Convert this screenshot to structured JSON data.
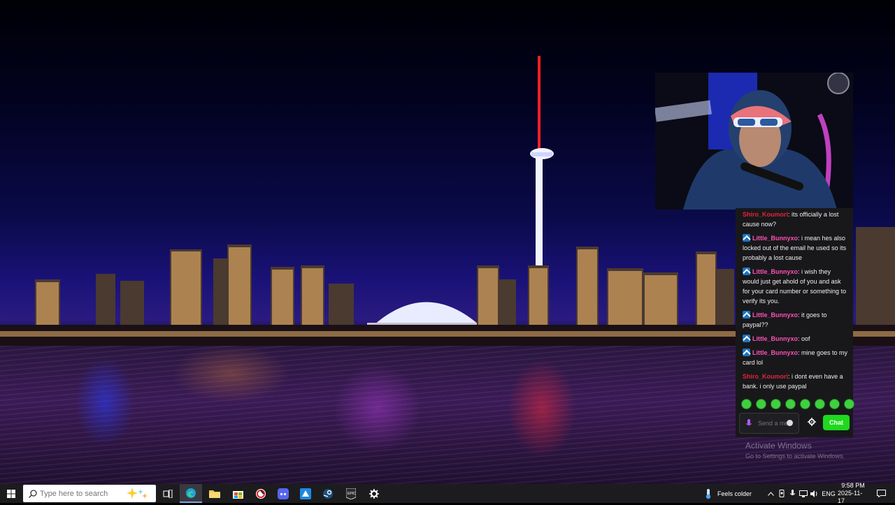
{
  "desktop": {
    "wallpaper": "toronto-skyline-night",
    "watermark": {
      "title": "Activate Windows",
      "subtitle": "Go to Settings to activate Windows."
    }
  },
  "chat": {
    "messages": [
      {
        "user": "Shiro_Koumori",
        "badge": false,
        "color": "#e0253a",
        "text": "its officially a lost cause now?"
      },
      {
        "user": "Little_Bunnyxo",
        "badge": true,
        "color": "#ff4fb6",
        "text": "i mean hes also locked out of the email he used so its probably a lost cause"
      },
      {
        "user": "Little_Bunnyxo",
        "badge": true,
        "color": "#ff4fb6",
        "text": "i wish they would just get ahold of you and ask for your card number or something to verify its you."
      },
      {
        "user": "Little_Bunnyxo",
        "badge": true,
        "color": "#ff4fb6",
        "text": "it goes to paypal??"
      },
      {
        "user": "Little_Bunnyxo",
        "badge": true,
        "color": "#ff4fb6",
        "text": "oof"
      },
      {
        "user": "Little_Bunnyxo",
        "badge": true,
        "color": "#ff4fb6",
        "text": "mine goes to my card lol"
      },
      {
        "user": "Shiro_Koumori",
        "badge": false,
        "color": "#e0253a",
        "text": "i dont even have a bank. i only use paypal"
      }
    ],
    "emote_count": 8,
    "input_placeholder": "Send a message",
    "send_label": "Chat",
    "accent": "#1ed91e"
  },
  "taskbar": {
    "search_placeholder": "Type here to search",
    "weather_text": "Feels colder",
    "language": "ENG",
    "time": "9:58 PM",
    "date": "2025-11-17",
    "pinned_apps": [
      "task-view",
      "edge",
      "file-explorer",
      "store",
      "app-red",
      "app-discord",
      "app-blue",
      "steam",
      "epic-games",
      "settings"
    ]
  }
}
